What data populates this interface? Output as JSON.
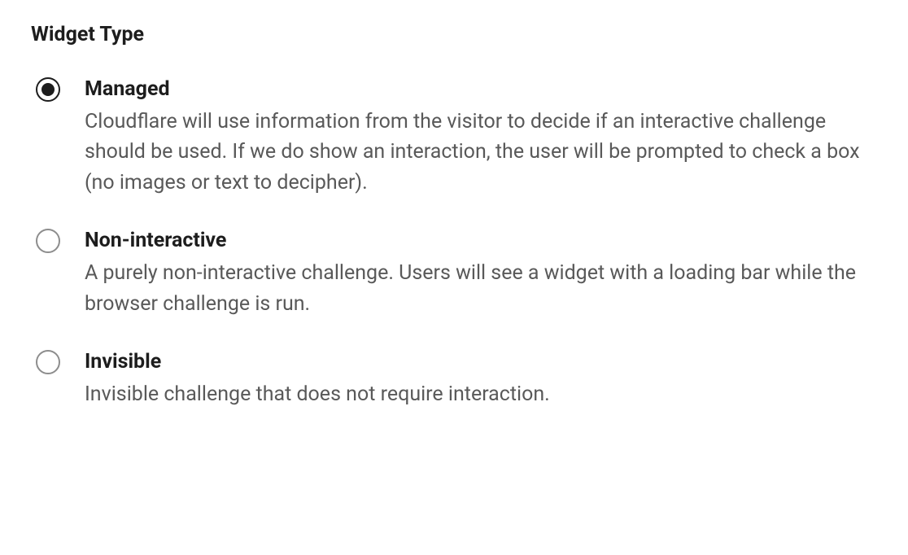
{
  "section_title": "Widget Type",
  "options": [
    {
      "id": "managed",
      "label": "Managed",
      "description": "Cloudflare will use information from the visitor to decide if an interactive challenge should be used. If we do show an interaction, the user will be prompted to check a box (no images or text to decipher).",
      "selected": true
    },
    {
      "id": "non-interactive",
      "label": "Non-interactive",
      "description": "A purely non-interactive challenge. Users will see a widget with a loading bar while the browser challenge is run.",
      "selected": false
    },
    {
      "id": "invisible",
      "label": "Invisible",
      "description": "Invisible challenge that does not require interaction.",
      "selected": false
    }
  ]
}
